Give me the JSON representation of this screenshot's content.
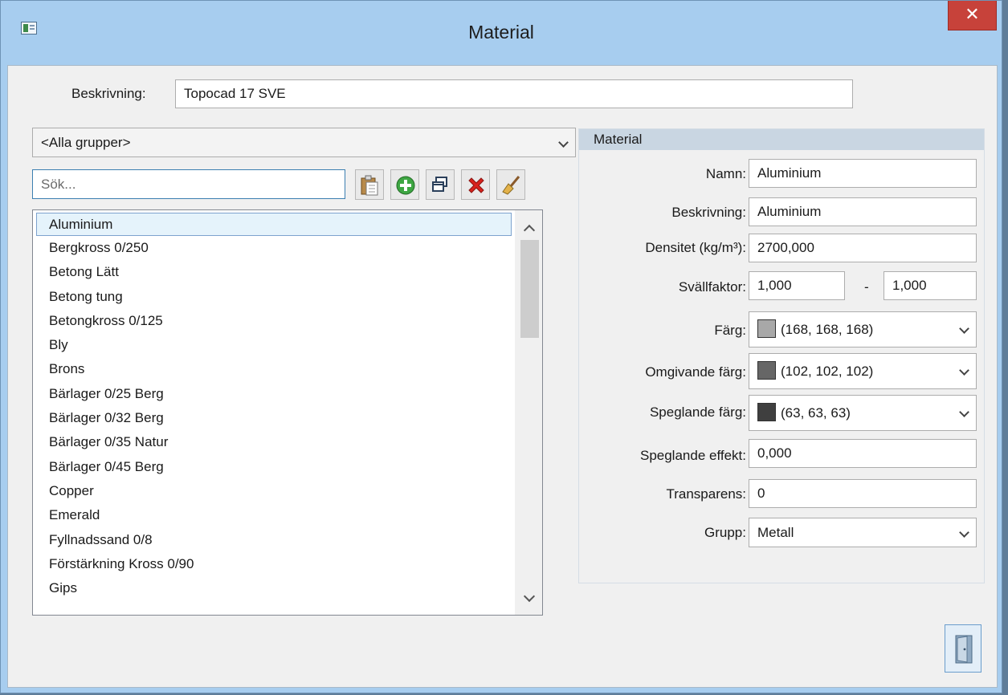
{
  "window": {
    "title": "Material",
    "close_glyph": "✕"
  },
  "description": {
    "label": "Beskrivning:",
    "value": "Topocad 17 SVE"
  },
  "group_filter": {
    "selected": "<Alla grupper>"
  },
  "search": {
    "placeholder": "Sök..."
  },
  "toolbar": {
    "icons": [
      "paste-icon",
      "add-icon",
      "duplicate-icon",
      "delete-icon",
      "clear-icon"
    ]
  },
  "materials_list": {
    "items": [
      "Aluminium",
      "Bergkross 0/250",
      "Betong Lätt",
      "Betong tung",
      "Betongkross 0/125",
      "Bly",
      "Brons",
      "Bärlager 0/25 Berg",
      "Bärlager 0/32 Berg",
      "Bärlager 0/35 Natur",
      "Bärlager 0/45 Berg",
      "Copper",
      "Emerald",
      "Fyllnadssand 0/8",
      "Förstärkning Kross 0/90",
      "Gips"
    ],
    "selected_index": 0
  },
  "material_panel": {
    "header": "Material",
    "name_label": "Namn:",
    "name_value": "Aluminium",
    "description_label": "Beskrivning:",
    "description_value": "Aluminium",
    "density_label": "Densitet (kg/m³):",
    "density_value": "2700,000",
    "swell_label": "Svällfaktor:",
    "swell_min": "1,000",
    "swell_sep": "-",
    "swell_max": "1,000",
    "color_label": "Färg:",
    "color_value": "(168, 168, 168)",
    "color_hex": "#a8a8a8",
    "ambient_label": "Omgivande färg:",
    "ambient_value": "(102, 102, 102)",
    "ambient_hex": "#666666",
    "specular_label": "Speglande färg:",
    "specular_value": "(63, 63, 63)",
    "specular_hex": "#3f3f3f",
    "specular_effect_label": "Speglande effekt:",
    "specular_effect_value": "0,000",
    "transparency_label": "Transparens:",
    "transparency_value": "0",
    "group_label": "Grupp:",
    "group_value": "Metall"
  },
  "footer": {
    "close_icon": "door-exit-icon"
  }
}
